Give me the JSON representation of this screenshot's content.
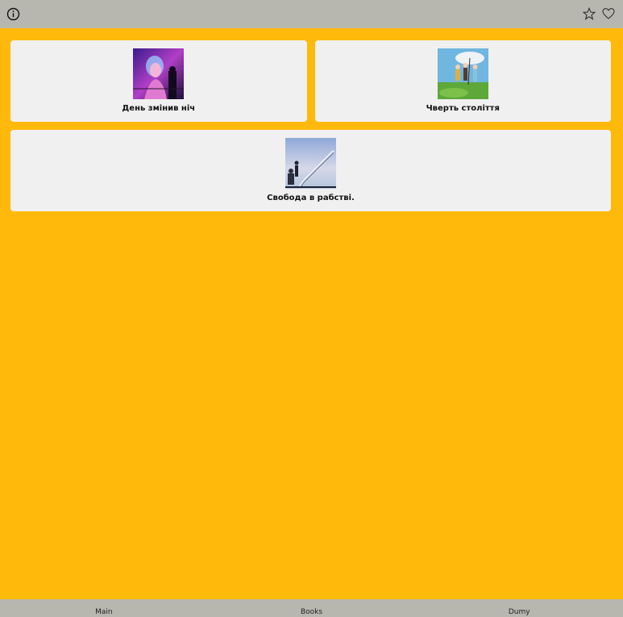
{
  "topbar": {
    "info_icon": "info-icon",
    "star_icon": "star-icon",
    "heart_icon": "heart-icon"
  },
  "cards": [
    {
      "title": "День змінив ніч",
      "image": "neon-portrait-image"
    },
    {
      "title": "Чверть століття",
      "image": "meadow-picnic-image"
    },
    {
      "title": "Свобода в рабстві.",
      "image": "stairs-silhouette-image"
    }
  ],
  "bottom_nav": {
    "items": [
      {
        "label": "Main"
      },
      {
        "label": "Books"
      },
      {
        "label": "Dumy"
      }
    ]
  },
  "colors": {
    "background": "#FFB90A",
    "bar": "#B8B7AF",
    "card": "#F0F0F0"
  }
}
